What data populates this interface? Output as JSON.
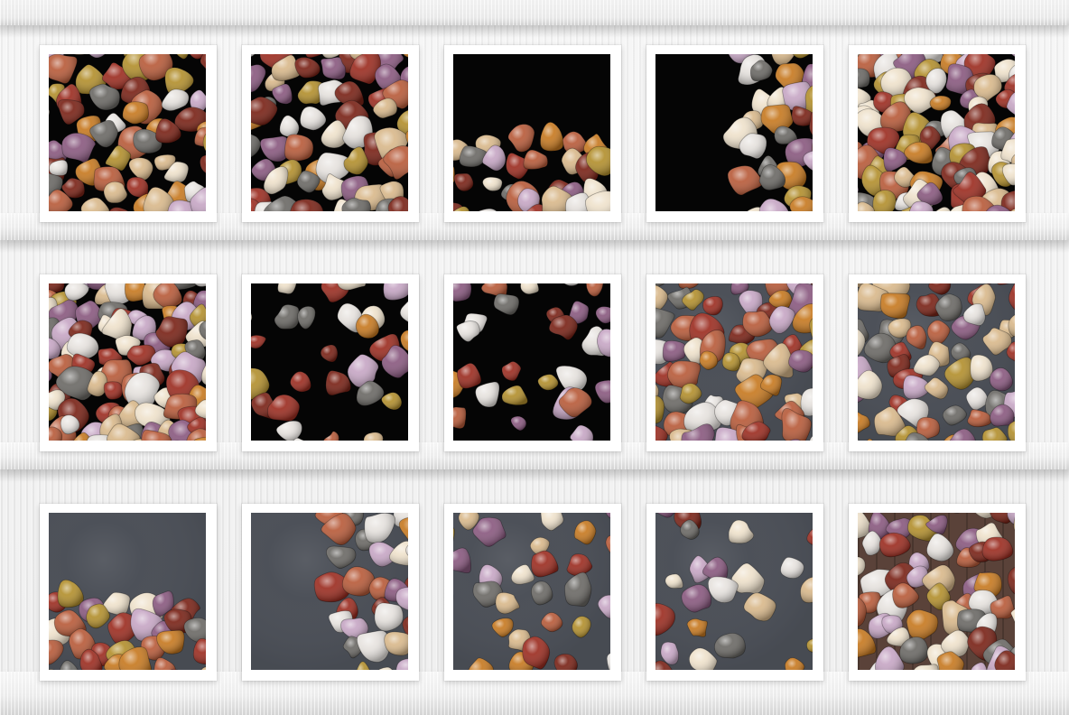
{
  "image": {
    "description_kind": "collage",
    "layout": {
      "rows": 3,
      "columns": 5
    },
    "shelf_color": "#ececec",
    "frame_color": "#ffffff",
    "palette": {
      "black": "#050505",
      "slate": "#4b4f57",
      "wood": "#5a4239",
      "carnelian": "#9c2e22",
      "agate_red": "#7a2418",
      "amber": "#c77a22",
      "lavender": "#c7a7c5",
      "mauve": "#8a5a80",
      "milky": "#e7e3df",
      "smoky": "#6c6a66",
      "ochre": "#b3902f",
      "sand": "#d9b98c",
      "jasper": "#b85c3b",
      "cream": "#efe2cc"
    },
    "tiles": [
      {
        "background": "black",
        "layout": "full"
      },
      {
        "background": "black",
        "layout": "full"
      },
      {
        "background": "black",
        "layout": "bottom-band"
      },
      {
        "background": "black",
        "layout": "right-band"
      },
      {
        "background": "black",
        "layout": "full-dense"
      },
      {
        "background": "black",
        "layout": "full-dense"
      },
      {
        "background": "black",
        "layout": "sparse"
      },
      {
        "background": "black",
        "layout": "sparse"
      },
      {
        "background": "slate",
        "layout": "full"
      },
      {
        "background": "slate",
        "layout": "full"
      },
      {
        "background": "slate",
        "layout": "bottom-band"
      },
      {
        "background": "slate",
        "layout": "right-band"
      },
      {
        "background": "slate",
        "layout": "sparse"
      },
      {
        "background": "slate",
        "layout": "sparse"
      },
      {
        "background": "wood",
        "layout": "full"
      }
    ]
  }
}
